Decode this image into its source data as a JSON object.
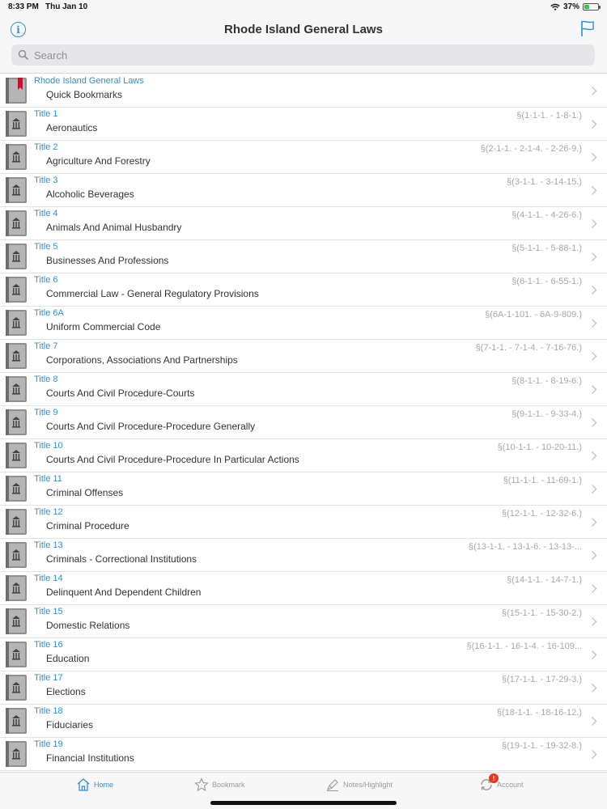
{
  "status": {
    "time": "8:33 PM",
    "date": "Thu Jan 10",
    "battery": "37%",
    "battery_level": 0.37
  },
  "nav": {
    "title": "Rhode Island General Laws",
    "search_placeholder": "Search"
  },
  "rows": [
    {
      "title": "Rhode Island General Laws",
      "name": "Quick Bookmarks",
      "range": "",
      "icon": "bookmark-book-icon"
    },
    {
      "title": "Title 1",
      "name": "Aeronautics",
      "range": "§(1-1-1. - 1-8-1.)",
      "icon": "law-book-icon"
    },
    {
      "title": "Title 2",
      "name": "Agriculture And Forestry",
      "range": "§(2-1-1. - 2-1-4. - 2-26-9.)",
      "icon": "law-book-icon"
    },
    {
      "title": "Title 3",
      "name": "Alcoholic Beverages",
      "range": "§(3-1-1. - 3-14-15.)",
      "icon": "law-book-icon"
    },
    {
      "title": "Title 4",
      "name": "Animals And Animal Husbandry",
      "range": "§(4-1-1. - 4-26-6.)",
      "icon": "law-book-icon"
    },
    {
      "title": "Title 5",
      "name": "Businesses And Professions",
      "range": "§(5-1-1. - 5-88-1.)",
      "icon": "law-book-icon"
    },
    {
      "title": "Title 6",
      "name": "Commercial Law - General Regulatory Provisions",
      "range": "§(6-1-1. - 6-55-1.)",
      "icon": "law-book-icon"
    },
    {
      "title": "Title 6A",
      "name": "Uniform Commercial Code",
      "range": "§(6A-1-101. - 6A-9-809.)",
      "icon": "law-book-icon"
    },
    {
      "title": "Title 7",
      "name": "Corporations, Associations And Partnerships",
      "range": "§(7-1-1. - 7-1-4. - 7-16-76.)",
      "icon": "law-book-icon"
    },
    {
      "title": "Title 8",
      "name": "Courts And Civil Procedure-Courts",
      "range": "§(8-1-1. - 8-19-6.)",
      "icon": "law-book-icon"
    },
    {
      "title": "Title 9",
      "name": "Courts And Civil Procedure-Procedure Generally",
      "range": "§(9-1-1. - 9-33-4.)",
      "icon": "law-book-icon"
    },
    {
      "title": "Title 10",
      "name": "Courts And Civil Procedure-Procedure In Particular Actions",
      "range": "§(10-1-1. - 10-20-11.)",
      "icon": "law-book-icon"
    },
    {
      "title": "Title 11",
      "name": "Criminal Offenses",
      "range": "§(11-1-1. - 11-69-1.)",
      "icon": "law-book-icon"
    },
    {
      "title": "Title 12",
      "name": "Criminal Procedure",
      "range": "§(12-1-1. - 12-32-6.)",
      "icon": "law-book-icon"
    },
    {
      "title": "Title 13",
      "name": "Criminals - Correctional Institutions",
      "range": "§(13-1-1. - 13-1-6. - 13-13-...",
      "icon": "law-book-icon"
    },
    {
      "title": "Title 14",
      "name": "Delinquent And Dependent Children",
      "range": "§(14-1-1. - 14-7-1.)",
      "icon": "law-book-icon"
    },
    {
      "title": "Title 15",
      "name": "Domestic Relations",
      "range": "§(15-1-1. - 15-30-2.)",
      "icon": "law-book-icon"
    },
    {
      "title": "Title 16",
      "name": "Education",
      "range": "§(16-1-1. - 16-1-4. - 16-109...",
      "icon": "law-book-icon"
    },
    {
      "title": "Title 17",
      "name": "Elections",
      "range": "§(17-1-1. - 17-29-3.)",
      "icon": "law-book-icon"
    },
    {
      "title": "Title 18",
      "name": "Fiduciaries",
      "range": "§(18-1-1. - 18-16-12.)",
      "icon": "law-book-icon"
    },
    {
      "title": "Title 19",
      "name": "Financial Institutions",
      "range": "§(19-1-1. - 19-32-8.)",
      "icon": "law-book-icon"
    }
  ],
  "tabs": [
    {
      "label": "Home",
      "icon": "home-icon",
      "active": true
    },
    {
      "label": "Bookmark",
      "icon": "star-icon",
      "active": false
    },
    {
      "label": "Notes/Highlight",
      "icon": "pen-icon",
      "active": false
    },
    {
      "label": "Account",
      "icon": "sync-icon",
      "active": false,
      "badge": "!"
    }
  ],
  "colors": {
    "accent": "#2f8fd6",
    "badge": "#e8391d",
    "bookmark_ribbon": "#c8102e"
  }
}
